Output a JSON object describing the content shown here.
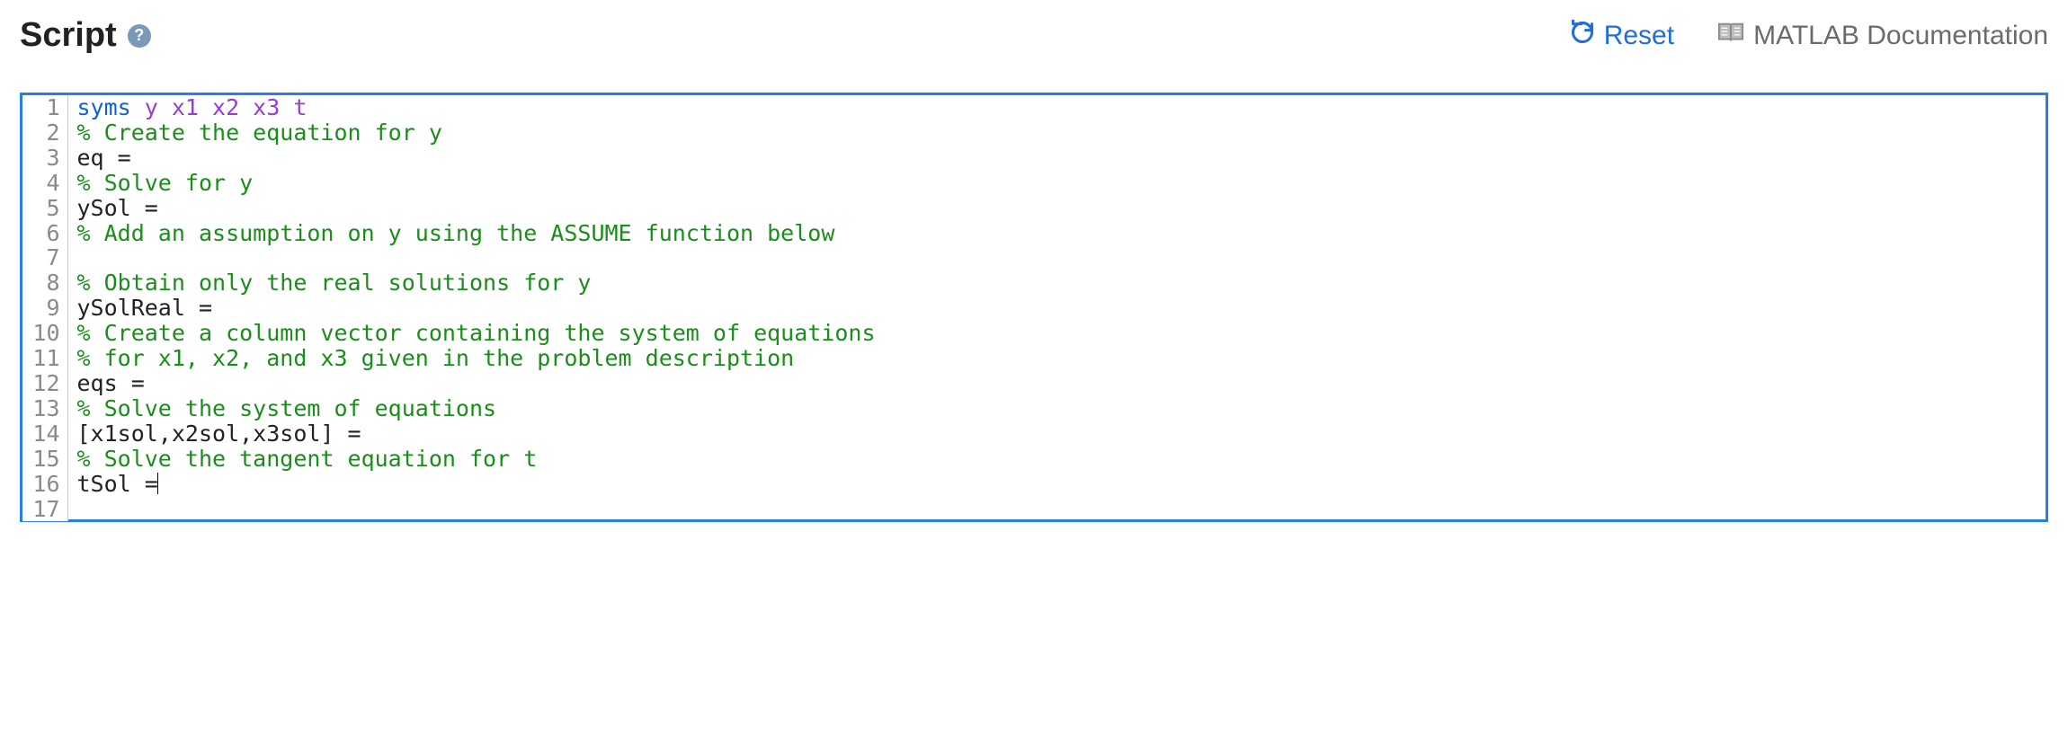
{
  "header": {
    "title": "Script",
    "reset_label": "Reset",
    "docs_label": "MATLAB Documentation"
  },
  "code": {
    "lines": [
      {
        "n": "1",
        "tokens": [
          {
            "t": "syms ",
            "c": "kw"
          },
          {
            "t": "y x1 x2 x3 t",
            "c": "var"
          }
        ]
      },
      {
        "n": "2",
        "tokens": [
          {
            "t": "% Create the equation for y",
            "c": "cm"
          }
        ]
      },
      {
        "n": "3",
        "tokens": [
          {
            "t": "eq = ",
            "c": ""
          }
        ]
      },
      {
        "n": "4",
        "tokens": [
          {
            "t": "% Solve for y",
            "c": "cm"
          }
        ]
      },
      {
        "n": "5",
        "tokens": [
          {
            "t": "ySol = ",
            "c": ""
          }
        ]
      },
      {
        "n": "6",
        "tokens": [
          {
            "t": "% Add an assumption on y using the ASSUME function below",
            "c": "cm"
          }
        ]
      },
      {
        "n": "7",
        "tokens": [
          {
            "t": "",
            "c": ""
          }
        ]
      },
      {
        "n": "8",
        "tokens": [
          {
            "t": "% Obtain only the real solutions for y",
            "c": "cm"
          }
        ]
      },
      {
        "n": "9",
        "tokens": [
          {
            "t": "ySolReal = ",
            "c": ""
          }
        ]
      },
      {
        "n": "10",
        "tokens": [
          {
            "t": "% Create a column vector containing the system of equations",
            "c": "cm"
          }
        ]
      },
      {
        "n": "11",
        "tokens": [
          {
            "t": "% for x1, x2, and x3 given in the problem description",
            "c": "cm"
          }
        ]
      },
      {
        "n": "12",
        "tokens": [
          {
            "t": "eqs = ",
            "c": ""
          }
        ]
      },
      {
        "n": "13",
        "tokens": [
          {
            "t": "% Solve the system of equations",
            "c": "cm"
          }
        ]
      },
      {
        "n": "14",
        "tokens": [
          {
            "t": "[x1sol,x2sol,x3sol] = ",
            "c": ""
          }
        ]
      },
      {
        "n": "15",
        "tokens": [
          {
            "t": "% Solve the tangent equation for t",
            "c": "cm"
          }
        ]
      },
      {
        "n": "16",
        "tokens": [
          {
            "t": "tSol =",
            "c": ""
          }
        ],
        "cursor": true
      },
      {
        "n": "17",
        "tokens": [
          {
            "t": "",
            "c": ""
          }
        ]
      }
    ]
  }
}
